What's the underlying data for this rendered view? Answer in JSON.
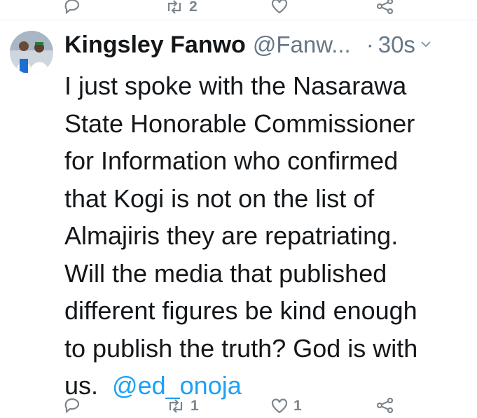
{
  "top_actions": {
    "retweet_count": "2"
  },
  "tweet": {
    "author_name": "Kingsley Fanwo",
    "handle": "@Fanw...",
    "separator": "·",
    "time": "30s",
    "lines": [
      "I just spoke with the Nasarawa",
      "State Honorable Commissioner",
      "for Information who confirmed",
      "that Kogi is not on the list of",
      "Almajiris they are repatriating.",
      "Will the media that published",
      "different figures be kind enough",
      "to publish the truth? God is with"
    ],
    "last_line_text": "us.",
    "mention": "@ed_onoja",
    "retweet_count": "1",
    "like_count": "1"
  },
  "colors": {
    "text": "#14171a",
    "muted": "#657786",
    "icon": "#7d868d",
    "link": "#1da1f2"
  }
}
